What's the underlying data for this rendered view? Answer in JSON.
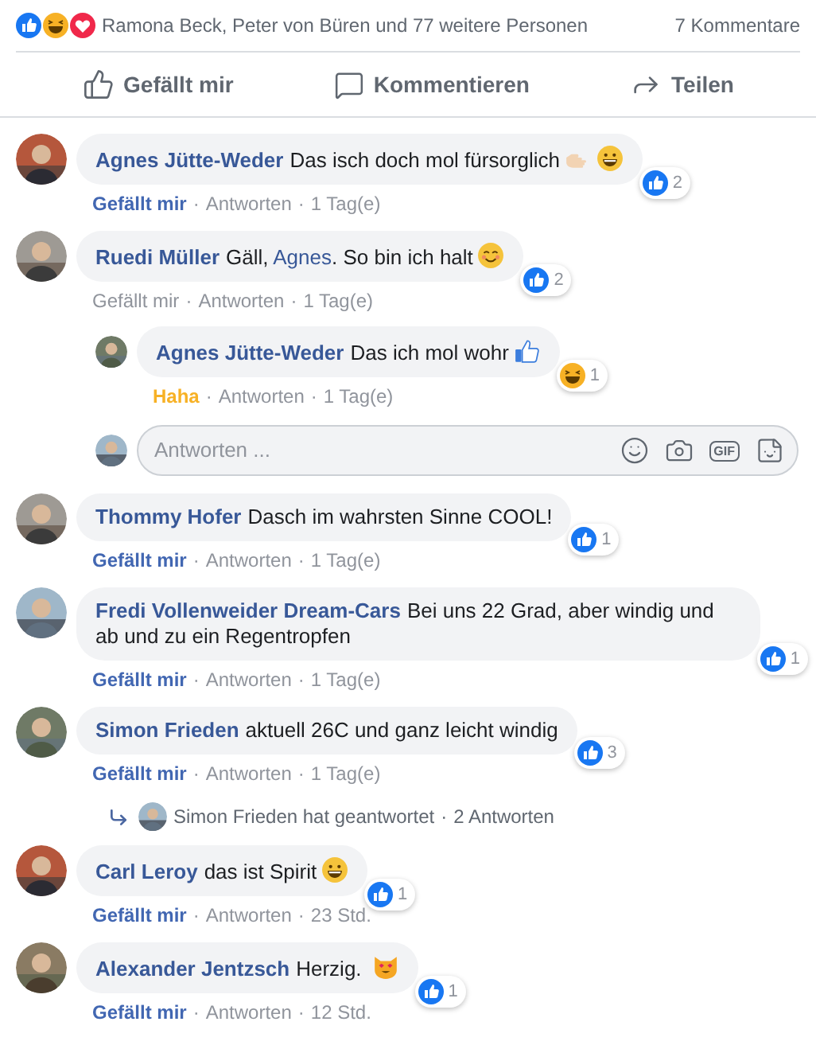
{
  "summary": {
    "reactions": [
      {
        "kind": "like"
      },
      {
        "kind": "haha"
      },
      {
        "kind": "love"
      }
    ],
    "text": "Ramona Beck, Peter von Büren und 77 weitere Personen",
    "comments": "7 Kommentare"
  },
  "actions": [
    {
      "kind": "like",
      "label": "Gefällt mir"
    },
    {
      "kind": "comment",
      "label": "Kommentieren"
    },
    {
      "kind": "share",
      "label": "Teilen"
    }
  ],
  "comments": [
    {
      "author": "Agnes Jütte-Weder",
      "text": [
        {
          "kind": "plain",
          "text": "Das isch doch mol fürsorglich"
        }
      ],
      "emojis": [
        {
          "kind": "pointing-hand"
        },
        {
          "kind": "grin"
        }
      ],
      "badge": {
        "reactions": [
          {
            "kind": "like"
          }
        ],
        "count": "2"
      },
      "meta": {
        "kind": "like",
        "like": "Gefällt mir",
        "dot_1": "·",
        "reply": "Antworten",
        "dot_2": "·",
        "time": "1 Tag(e)"
      }
    },
    {
      "author": "Ruedi Müller",
      "text": [
        {
          "kind": "plain",
          "text": "Gäll, "
        },
        {
          "kind": "mention",
          "text": "Agnes"
        },
        {
          "kind": "plain",
          "text": ". So bin ich halt"
        }
      ],
      "emojis": [
        {
          "kind": "blush"
        }
      ],
      "badge": {
        "reactions": [
          {
            "kind": "like"
          }
        ],
        "count": "2"
      },
      "meta": {
        "kind": "none",
        "like": "Gefällt mir",
        "dot_1": "·",
        "reply": "Antworten",
        "dot_2": "·",
        "time": "1 Tag(e)"
      },
      "replies": [
        {
          "author": "Agnes Jütte-Weder",
          "text": [
            {
              "kind": "plain",
              "text": "Das ich mol wohr"
            }
          ],
          "emojis": [
            {
              "kind": "thumbs-up"
            }
          ],
          "badge": {
            "reactions": [
              {
                "kind": "haha"
              }
            ],
            "count": "1"
          },
          "meta": {
            "kind": "haha",
            "like": "Haha",
            "dot_1": "·",
            "reply": "Antworten",
            "dot_2": "·",
            "time": "1 Tag(e)"
          }
        }
      ],
      "reply_box": {
        "placeholder": "Antworten ...",
        "gif_label": "GIF"
      }
    },
    {
      "author": "Thommy Hofer",
      "text": [
        {
          "kind": "plain",
          "text": "Dasch im wahrsten Sinne COOL!"
        }
      ],
      "badge": {
        "reactions": [
          {
            "kind": "like"
          }
        ],
        "count": "1"
      },
      "meta": {
        "kind": "like",
        "like": "Gefällt mir",
        "dot_1": "·",
        "reply": "Antworten",
        "dot_2": "·",
        "time": "1 Tag(e)"
      }
    },
    {
      "author": "Fredi Vollenweider Dream-Cars",
      "text": [
        {
          "kind": "plain",
          "text": "Bei uns 22 Grad, aber windig und ab und zu ein Regentropfen"
        }
      ],
      "badge": {
        "reactions": [
          {
            "kind": "like"
          }
        ],
        "count": "1"
      },
      "meta": {
        "kind": "like",
        "like": "Gefällt mir",
        "dot_1": "·",
        "reply": "Antworten",
        "dot_2": "·",
        "time": "1 Tag(e)"
      }
    },
    {
      "author": "Simon Frieden",
      "text": [
        {
          "kind": "plain",
          "text": "aktuell 26C und ganz leicht windig"
        }
      ],
      "badge": {
        "reactions": [
          {
            "kind": "like"
          }
        ],
        "count": "3"
      },
      "meta": {
        "kind": "like",
        "like": "Gefällt mir",
        "dot_1": "·",
        "reply": "Antworten",
        "dot_2": "·",
        "time": "1 Tag(e)"
      },
      "replies_summary": {
        "text": "Simon Frieden hat geantwortet",
        "dot": "·",
        "count": "2 Antworten"
      }
    },
    {
      "author": "Carl Leroy",
      "text": [
        {
          "kind": "plain",
          "text": "das ist Spirit"
        }
      ],
      "emojis": [
        {
          "kind": "grin"
        }
      ],
      "badge": {
        "reactions": [
          {
            "kind": "like"
          }
        ],
        "count": "1"
      },
      "meta": {
        "kind": "like",
        "like": "Gefällt mir",
        "dot_1": "·",
        "reply": "Antworten",
        "dot_2": "·",
        "time": "23 Std."
      }
    },
    {
      "author": "Alexander Jentzsch",
      "text": [
        {
          "kind": "plain",
          "text": "Herzig. "
        }
      ],
      "emojis": [
        {
          "kind": "cat"
        }
      ],
      "badge": {
        "reactions": [
          {
            "kind": "like"
          }
        ],
        "count": "1"
      },
      "meta": {
        "kind": "like",
        "like": "Gefällt mir",
        "dot_1": "·",
        "reply": "Antworten",
        "dot_2": "·",
        "time": "12 Std."
      }
    }
  ]
}
